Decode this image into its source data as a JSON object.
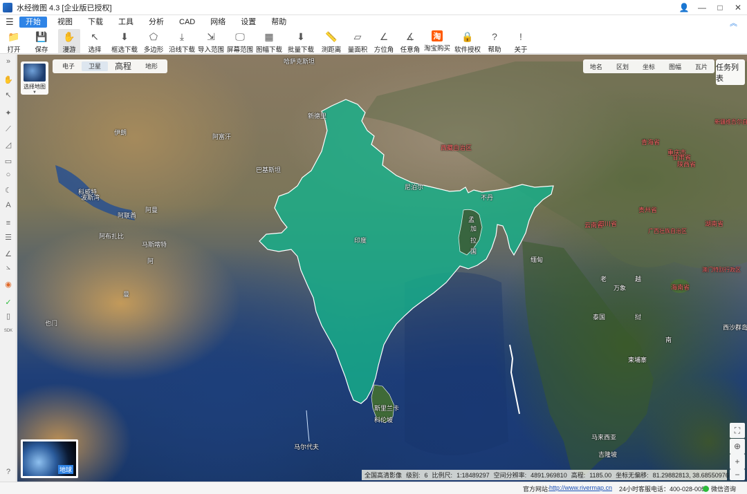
{
  "window": {
    "title": "水经微图 4.3 [企业版已授权]",
    "controls": {
      "user": "👤",
      "minimize": "—",
      "maximize": "□",
      "close": "✕"
    }
  },
  "menu": {
    "hamburger": "☰",
    "items": [
      "开始",
      "视图",
      "下载",
      "工具",
      "分析",
      "CAD",
      "网络",
      "设置",
      "帮助"
    ],
    "collapse": "︽"
  },
  "toolbar": {
    "tools": [
      {
        "label": "打开",
        "icon": "folder-icon",
        "glyph": "📁"
      },
      {
        "label": "保存",
        "icon": "save-icon",
        "glyph": "💾"
      },
      {
        "label": "漫游",
        "icon": "hand-icon",
        "glyph": "✋"
      },
      {
        "label": "选择",
        "icon": "cursor-icon",
        "glyph": "↖"
      },
      {
        "label": "框选下载",
        "icon": "rect-download-icon",
        "glyph": "⬇"
      },
      {
        "label": "多边形",
        "icon": "polygon-icon",
        "glyph": "⬠"
      },
      {
        "label": "沿线下载",
        "icon": "line-download-icon",
        "glyph": "⤓"
      },
      {
        "label": "导入范围",
        "icon": "import-icon",
        "glyph": "⇲"
      },
      {
        "label": "屏幕范围",
        "icon": "screen-icon",
        "glyph": "🖵"
      },
      {
        "label": "图幅下载",
        "icon": "sheet-download-icon",
        "glyph": "▦"
      },
      {
        "label": "批量下载",
        "icon": "batch-download-icon",
        "glyph": "⬇"
      },
      {
        "label": "测距离",
        "icon": "ruler-icon",
        "glyph": "📏"
      },
      {
        "label": "量面积",
        "icon": "area-icon",
        "glyph": "▱"
      },
      {
        "label": "方位角",
        "icon": "azimuth-icon",
        "glyph": "∠"
      },
      {
        "label": "任意角",
        "icon": "angle-icon",
        "glyph": "∡"
      },
      {
        "label": "淘宝购买",
        "icon": "taobao-icon",
        "glyph": "淘"
      },
      {
        "label": "软件授权",
        "icon": "lock-icon",
        "glyph": "🔒"
      },
      {
        "label": "帮助",
        "icon": "help-icon",
        "glyph": "?"
      },
      {
        "label": "关于",
        "icon": "info-icon",
        "glyph": "!"
      }
    ]
  },
  "leftbar": {
    "expand": "»",
    "items": [
      {
        "name": "hand-icon",
        "glyph": "✋"
      },
      {
        "name": "pointer-icon",
        "glyph": "↖"
      },
      {
        "name": "marker-icon",
        "glyph": "✦"
      },
      {
        "name": "polyline-icon",
        "glyph": "⟋"
      },
      {
        "name": "area-icon",
        "glyph": "◿"
      },
      {
        "name": "rectangle-icon",
        "glyph": "▭"
      },
      {
        "name": "circle-icon",
        "glyph": "○"
      },
      {
        "name": "sector-icon",
        "glyph": "☾"
      },
      {
        "name": "text-icon",
        "glyph": "A"
      },
      {
        "name": "ruler-icon",
        "glyph": "≡"
      },
      {
        "name": "layers-icon",
        "glyph": "☰"
      },
      {
        "name": "angle-icon",
        "glyph": "∠"
      },
      {
        "name": "protractor-icon",
        "glyph": "⦣"
      },
      {
        "name": "globe-icon",
        "glyph": "◉"
      },
      {
        "name": "check-icon",
        "glyph": "✓"
      },
      {
        "name": "doc-icon",
        "glyph": "▯"
      },
      {
        "name": "sdk-icon",
        "glyph": "SDK"
      },
      {
        "name": "help-icon",
        "glyph": "?"
      }
    ]
  },
  "map": {
    "map_select_label": "选择地图",
    "map_types": [
      "电子",
      "卫星",
      "高程",
      "地形"
    ],
    "active_map_type": "卫星",
    "layers": [
      "地名",
      "区划",
      "坐标",
      "图幅",
      "瓦片"
    ],
    "task_list": "任务列表",
    "earth_label": "地球",
    "labels": [
      {
        "text": "伊朗",
        "prov": false
      },
      {
        "text": "阿富汗",
        "prov": false
      },
      {
        "text": "巴基斯坦",
        "prov": false
      },
      {
        "text": "阿曼",
        "prov": false
      },
      {
        "text": "阿联酋",
        "prov": false
      },
      {
        "text": "科威特",
        "prov": false
      },
      {
        "text": "波斯湾",
        "prov": false
      },
      {
        "text": "阿布扎比",
        "prov": false
      },
      {
        "text": "马斯喀特",
        "prov": false
      },
      {
        "text": "也门",
        "prov": false
      },
      {
        "text": "曼",
        "prov": false
      },
      {
        "text": "阿",
        "prov": false
      },
      {
        "text": "哈萨克斯坦",
        "prov": false
      },
      {
        "text": "新德里",
        "prov": false
      },
      {
        "text": "印度",
        "prov": false
      },
      {
        "text": "尼泊尔",
        "prov": false
      },
      {
        "text": "不丹",
        "prov": false
      },
      {
        "text": "孟",
        "prov": false
      },
      {
        "text": "加",
        "prov": false
      },
      {
        "text": "拉",
        "prov": false
      },
      {
        "text": "国",
        "prov": false
      },
      {
        "text": "缅甸",
        "prov": false
      },
      {
        "text": "泰国",
        "prov": false
      },
      {
        "text": "老",
        "prov": false
      },
      {
        "text": "挝",
        "prov": false
      },
      {
        "text": "越",
        "prov": false
      },
      {
        "text": "南",
        "prov": false
      },
      {
        "text": "柬埔寨",
        "prov": false
      },
      {
        "text": "万象",
        "prov": false
      },
      {
        "text": "斯里兰卡",
        "prov": false
      },
      {
        "text": "科伦坡",
        "prov": false
      },
      {
        "text": "马尔代夫",
        "prov": false
      },
      {
        "text": "马来西亚",
        "prov": false
      },
      {
        "text": "吉隆坡",
        "prov": false
      },
      {
        "text": "西藏自治区",
        "prov": true
      },
      {
        "text": "青海省",
        "prov": true
      },
      {
        "text": "四川省",
        "prov": true
      },
      {
        "text": "甘肃省",
        "prov": true
      },
      {
        "text": "云南省",
        "prov": true
      },
      {
        "text": "贵州省",
        "prov": true
      },
      {
        "text": "重庆市",
        "prov": true
      },
      {
        "text": "广西壮族自治区",
        "prov": true
      },
      {
        "text": "海南省",
        "prov": true
      },
      {
        "text": "湖南省",
        "prov": true
      },
      {
        "text": "陕西省",
        "prov": true
      },
      {
        "text": "新疆维吾尔自治区",
        "prov": true
      },
      {
        "text": "澳门特别行政区",
        "prov": true
      },
      {
        "text": "西沙群岛",
        "prov": false
      }
    ],
    "coords": {
      "source": "全国高清影像",
      "level_label": "级别:",
      "level": "6",
      "scale_label": "比例尺:",
      "scale": "1:18489297",
      "resolution_label": "空间分辨率:",
      "resolution": "4891.969810",
      "elevation_label": "高程:",
      "elevation": "1185.00",
      "deviation": "坐标无偏移:",
      "lonlat": "81.29882813, 38.68550976"
    }
  },
  "status": {
    "website_label": "官方网站:",
    "website": "http://www.rivermap.cn",
    "hotline": "24小时客服电话：400-028-0050",
    "wechat": "微信咨询"
  },
  "colors": {
    "accent": "#2f84e6",
    "india_fill": "#16b08a",
    "province_label": "#ff6a6a"
  }
}
